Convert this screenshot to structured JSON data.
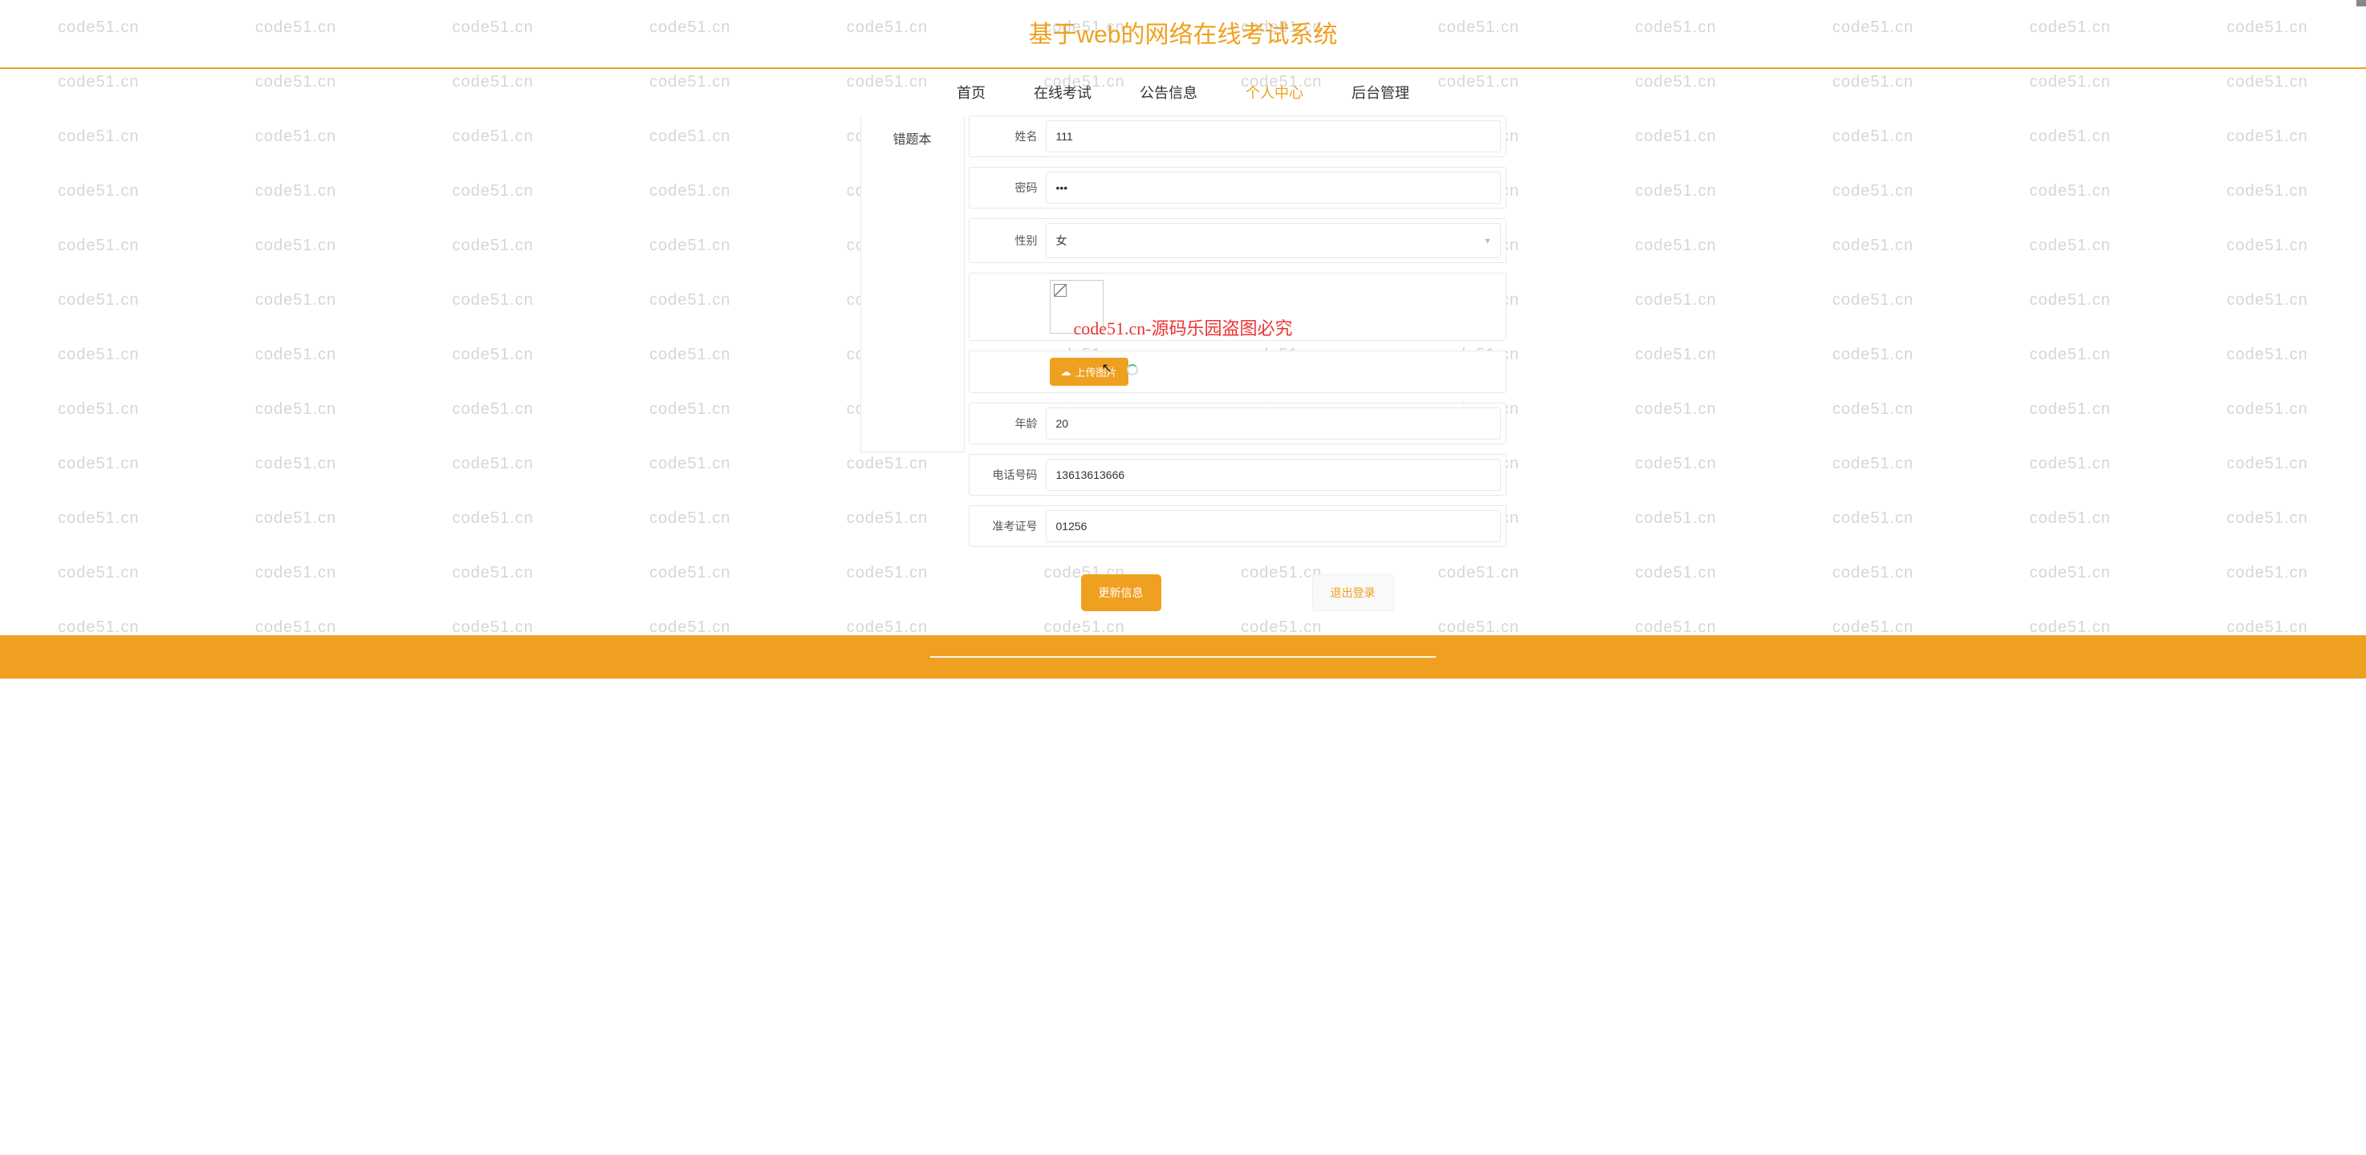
{
  "header": {
    "title": "基于web的网络在线考试系统"
  },
  "nav": {
    "items": [
      {
        "label": "首页",
        "active": false
      },
      {
        "label": "在线考试",
        "active": false
      },
      {
        "label": "公告信息",
        "active": false
      },
      {
        "label": "个人中心",
        "active": true
      },
      {
        "label": "后台管理",
        "active": false
      }
    ]
  },
  "sidebar": {
    "items": [
      {
        "label": "错题本"
      }
    ]
  },
  "form": {
    "name": {
      "label": "姓名",
      "value": "111"
    },
    "password": {
      "label": "密码",
      "value": "•••"
    },
    "gender": {
      "label": "性别",
      "value": "女"
    },
    "upload": {
      "button_label": "上传图片",
      "icon": "cloud-upload"
    },
    "age": {
      "label": "年龄",
      "value": "20"
    },
    "phone": {
      "label": "电话号码",
      "value": "13613613666"
    },
    "exam_id": {
      "label": "准考证号",
      "value": "01256"
    }
  },
  "buttons": {
    "update": "更新信息",
    "logout": "退出登录"
  },
  "overlay": {
    "text": "code51.cn-源码乐园盗图必究"
  },
  "watermark": {
    "text": "code51.cn"
  }
}
